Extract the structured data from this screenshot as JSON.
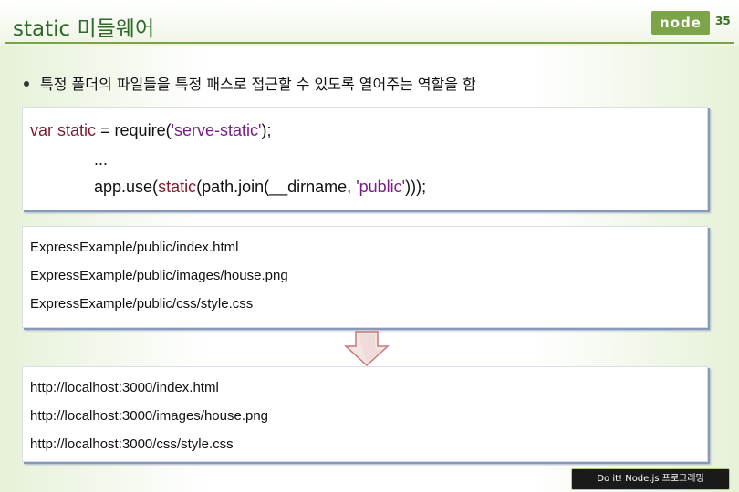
{
  "slide": {
    "title": "static 미들웨어",
    "page_number": "35",
    "logo_text": "node",
    "bullet": "특정 폴더의 파일들을 특정 패스로 접근할 수 있도록 열어주는 역할을 함",
    "footer": "Do it! Node.js 프로그래밍"
  },
  "code": {
    "line1_keyword": "var static",
    "line1_mid": " = require(",
    "line1_string": "'serve-static'",
    "line1_end": ");",
    "line2": "...",
    "line3_pre": "app.use(",
    "line3_keyword": "static",
    "line3_mid": "(path.join(__dirname, ",
    "line3_string": "'public'",
    "line3_end": ")));"
  },
  "paths": [
    "ExpressExample/public/index.html",
    "ExpressExample/public/images/house.png",
    "ExpressExample/public/css/style.css"
  ],
  "urls": [
    "http://localhost:3000/index.html",
    "http://localhost:3000/images/house.png",
    "http://localhost:3000/css/style.css"
  ],
  "icons": {
    "down_arrow": "down-arrow-icon",
    "bullet": "bullet-icon"
  },
  "colors": {
    "title": "#2f6a2a",
    "accent_green": "#7aa346",
    "keyword": "#7f1a30",
    "string": "#7a1c8a",
    "arrow_fill": "#f4e5e5",
    "arrow_stroke": "#c8787a"
  }
}
